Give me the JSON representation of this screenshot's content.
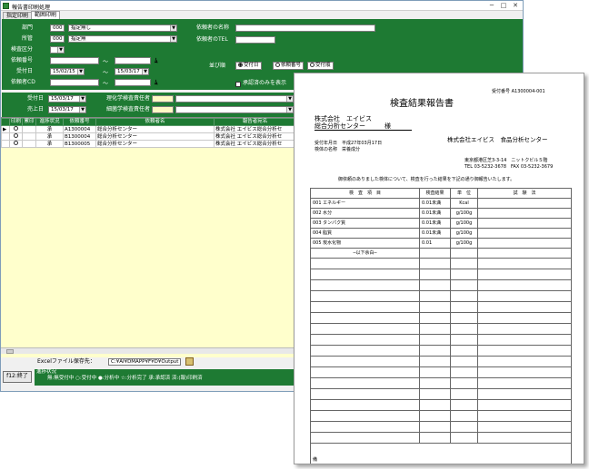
{
  "window": {
    "title": "報告書印刷処理",
    "tabs": [
      "指定印刷",
      "範囲印刷"
    ]
  },
  "filters": {
    "dept_label": "部門",
    "dept_code": "000",
    "dept_value": "指定無し",
    "office_label": "所管",
    "office_code": "000",
    "office_value": "指定無",
    "sample_cat_label": "検査区分",
    "req_no_label": "依頼番号",
    "receipt_date_label": "受付日",
    "receipt_from": "15/02/15",
    "receipt_to": "15/03/17",
    "client_cd_label": "依頼者CD",
    "client_name_label": "依頼者の名称",
    "client_tel_label": "依頼者のTEL",
    "sort_label": "並び順",
    "sort_options": [
      "受付日",
      "依頼番号",
      "受付順"
    ],
    "approved_only_label": "承認済のみを表示"
  },
  "dates": {
    "receipt_label": "受付日",
    "receipt_value": "15/03/17",
    "issue_label": "売上日",
    "issue_value": "15/03/17",
    "phys_label": "理化学検査責任者",
    "micro_label": "細菌学検査責任者"
  },
  "grid": {
    "headers": [
      "印刷",
      "累印",
      "進捗状況",
      "依頼番号",
      "依頼者名",
      "報告者宛名"
    ],
    "rows": [
      [
        "○",
        "",
        "承",
        "A1300004",
        "総合分析センター",
        "株式会社 エイビス総合分析セ"
      ],
      [
        "○",
        "",
        "承",
        "B1300004",
        "総合分析センター",
        "株式会社 エイビス総合分析セ"
      ],
      [
        "○",
        "",
        "承",
        "B1300005",
        "総合分析センター",
        "株式会社 エイビス総合分析セ"
      ]
    ]
  },
  "footer": {
    "excel_label": "Excelファイル保存先：",
    "excel_path": "C:¥AI¥DMAPP¥F¥D¥Output",
    "end_button": "f12:終了",
    "legend_title": "進捗状況",
    "legend_text": "無:無受付中 ○:受付中 ●:分析中 ☆:分析完了 承:承認済 済:(報)印刷済"
  },
  "report": {
    "title": "検査結果報告書",
    "receipt_no": "受付番号 A1300004-001",
    "addressee_1": "株式会社　エイビス",
    "addressee_2": "総合分析センター　　　様",
    "received_label": "受付年月日",
    "received_value": "平成27年03月17日",
    "sample_label": "検体の名称",
    "sample_value": "栄養成分",
    "issuer": "株式会社エイビス　食品分析センター",
    "address": "東京都港区芝3-3-14　ニットクビル５階",
    "tel_fax": "TEL 03-5232-3678　FAX 03-5232-3679",
    "intro": "御依頼のありました検体について、検査を行った結果を下記の通り御報告いたします。",
    "headers": [
      "検　査　項　目",
      "検査結果",
      "単　位",
      "試　験　法"
    ],
    "items": [
      [
        "001",
        "エネルギー",
        "0.01未満",
        "Kcal"
      ],
      [
        "002",
        "水分",
        "0.01未満",
        "g/100g"
      ],
      [
        "003",
        "タンパク質",
        "0.01未満",
        "g/100g"
      ],
      [
        "004",
        "脂質",
        "0.01未満",
        "g/100g"
      ],
      [
        "005",
        "炭水化物",
        "0.01",
        "g/100g"
      ]
    ],
    "end_text": "─以下余白─",
    "remarks_label": "備考"
  }
}
